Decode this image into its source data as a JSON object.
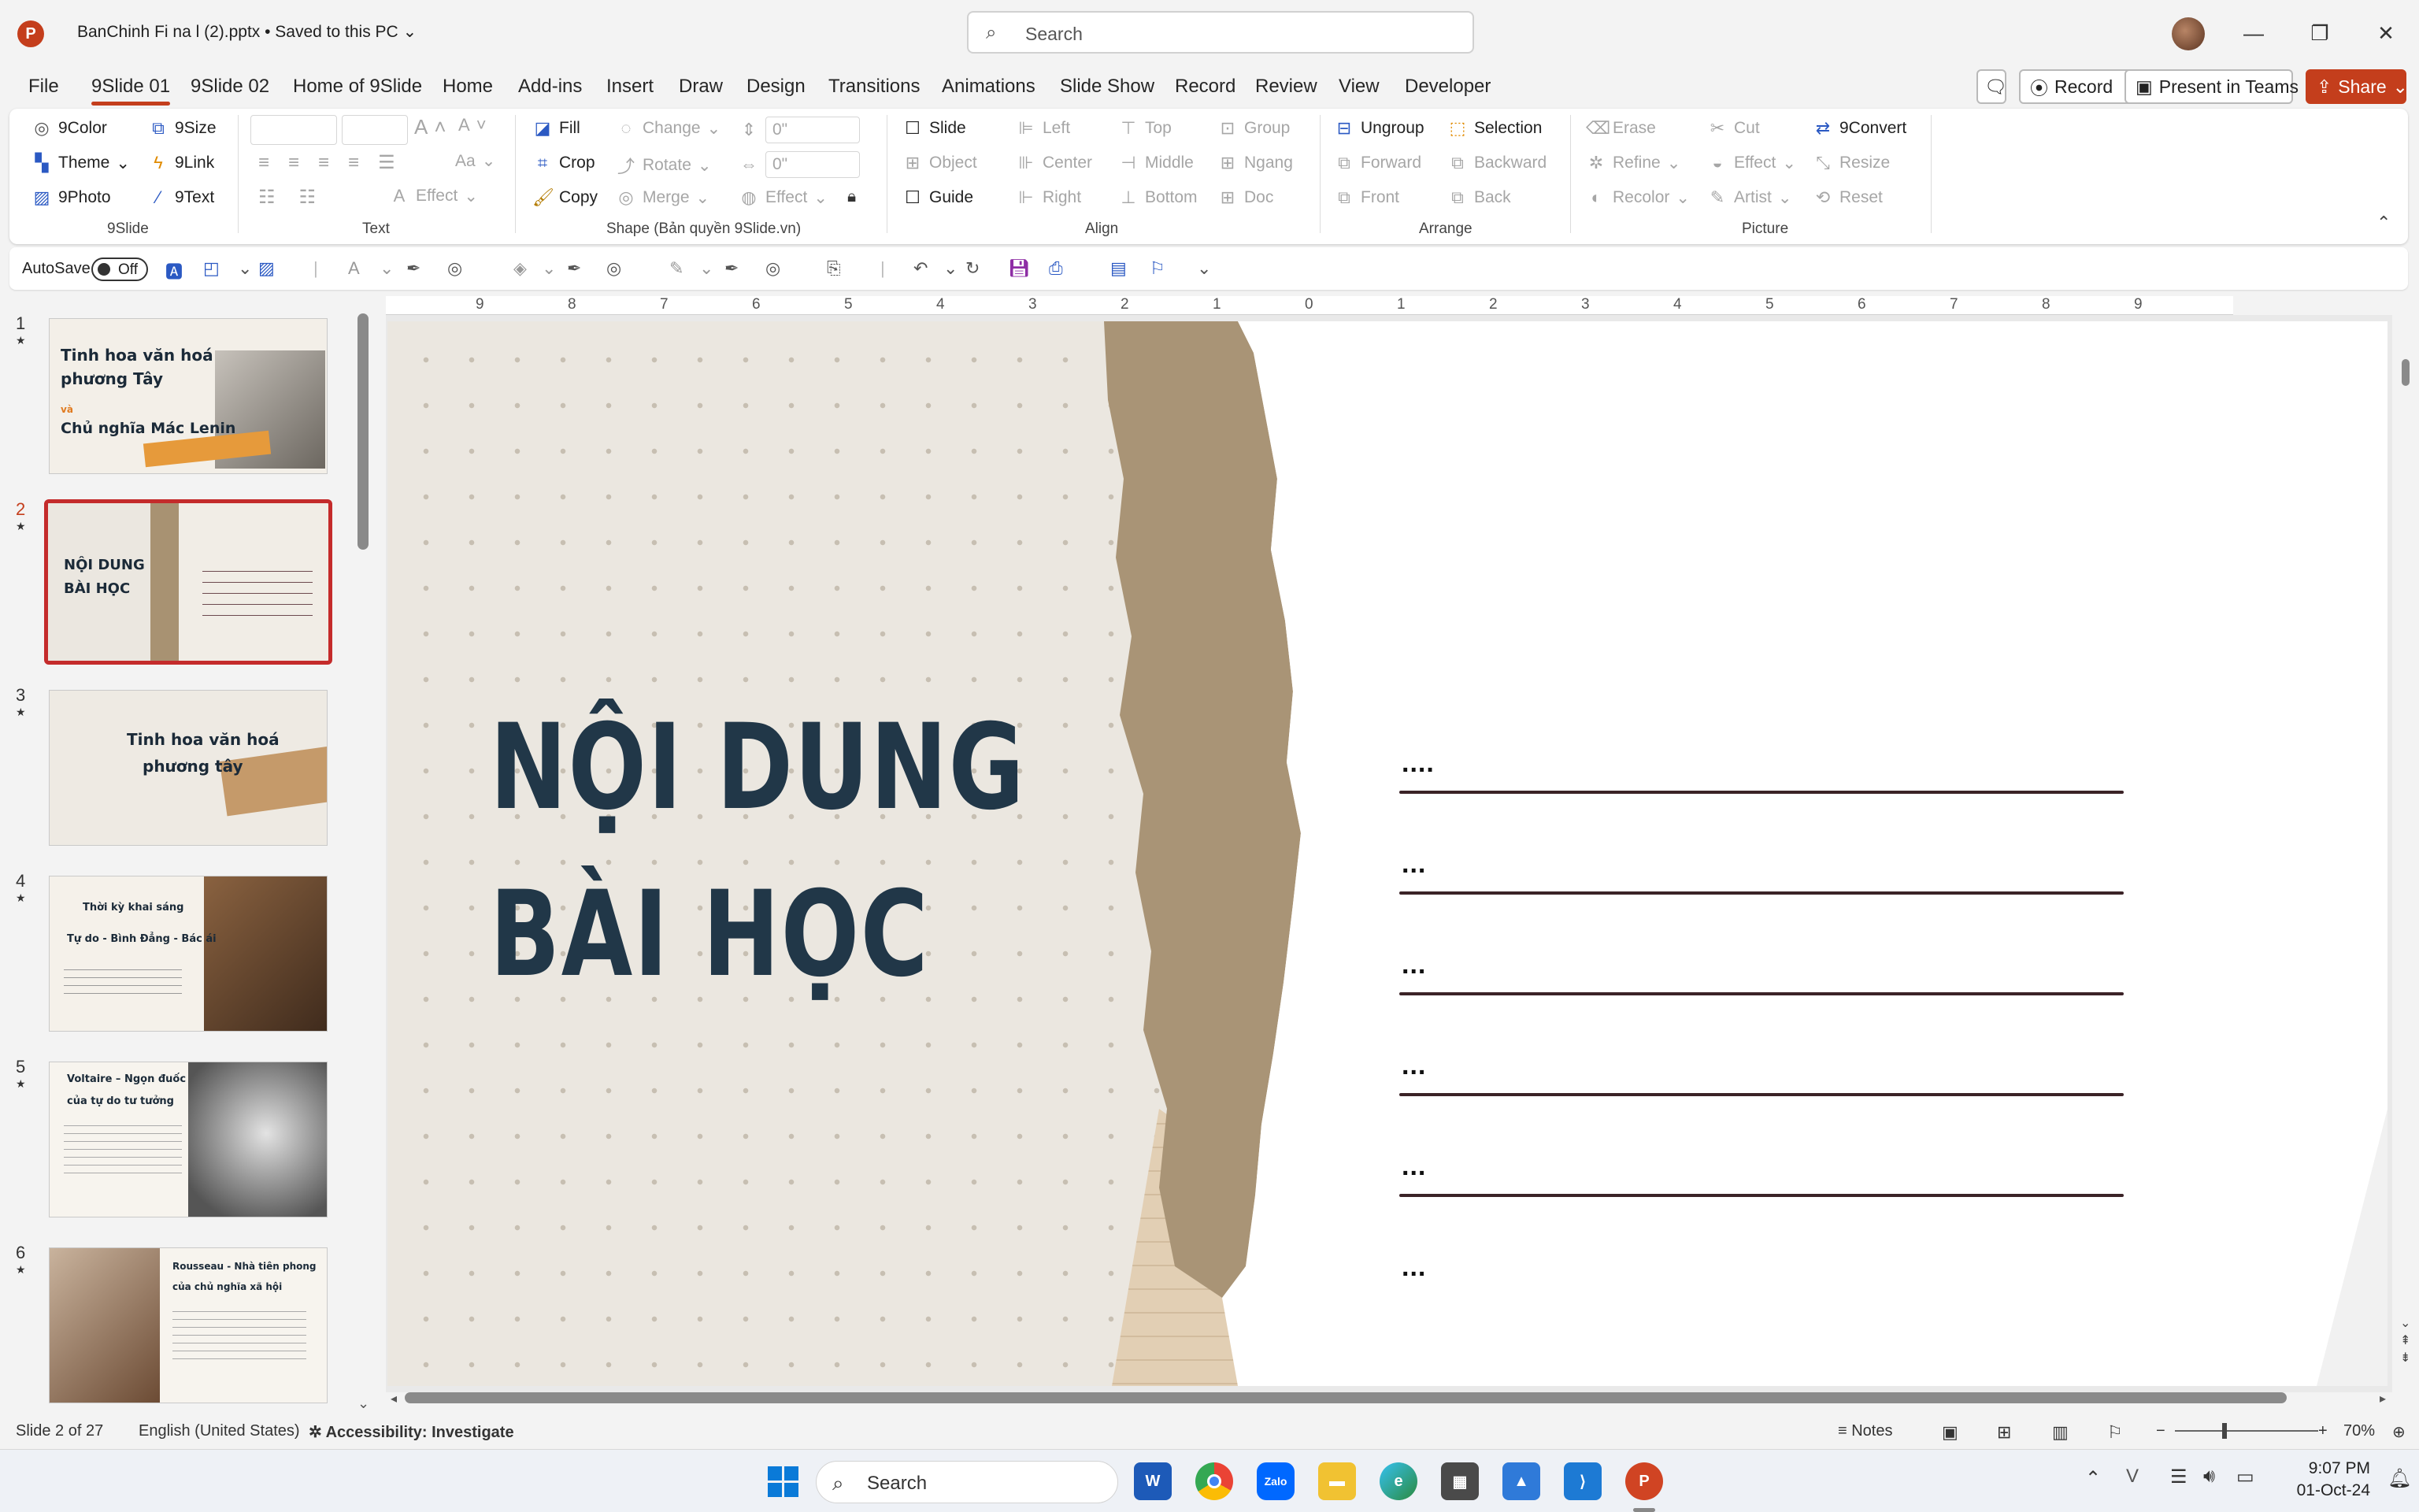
{
  "titlebar": {
    "app_icon": "P",
    "doc_title": "BanChinh Fi na l (2).pptx • Saved to this PC",
    "search_placeholder": "Search",
    "minimize": "—",
    "restore": "❐",
    "close": "✕"
  },
  "menu": {
    "tabs": [
      "File",
      "9Slide 01",
      "9Slide 02",
      "Home of 9Slide",
      "Home",
      "Add-ins",
      "Insert",
      "Draw",
      "Design",
      "Transitions",
      "Animations",
      "Slide Show",
      "Record",
      "Review",
      "View",
      "Developer"
    ],
    "record_label": "Record",
    "present_label": "Present in Teams",
    "share_label": "Share"
  },
  "ribbon": {
    "nineslide": {
      "color": "9Color",
      "theme": "Theme",
      "photo": "9Photo",
      "size": "9Size",
      "link": "9Link",
      "text": "9Text",
      "group": "9Slide"
    },
    "text": {
      "font_size_up": "A",
      "font_size_down": "A",
      "case": "Aa",
      "effect": "Effect",
      "group": "Text"
    },
    "shape": {
      "fill": "Fill",
      "crop": "Crop",
      "copy": "Copy",
      "change": "Change",
      "rotate": "Rotate",
      "merge": "Merge",
      "width_value": "0\"",
      "height_value": "0\"",
      "effect": "Effect",
      "group": "Shape (Bản quyền 9Slide.vn)"
    },
    "align": {
      "slide": "Slide",
      "object": "Object",
      "guide": "Guide",
      "left": "Left",
      "center": "Center",
      "right": "Right",
      "top": "Top",
      "middle": "Middle",
      "bottom": "Bottom",
      "group_btn": "Group",
      "ngang": "Ngang",
      "doc": "Doc",
      "group": "Align"
    },
    "arrange": {
      "ungroup": "Ungroup",
      "forward": "Forward",
      "front": "Front",
      "selection": "Selection",
      "backward": "Backward",
      "back": "Back",
      "group": "Arrange"
    },
    "picture": {
      "erase": "Erase",
      "refine": "Refine",
      "recolor": "Recolor",
      "cut": "Cut",
      "effect": "Effect",
      "artist": "Artist",
      "convert": "9Convert",
      "resize": "Resize",
      "reset": "Reset",
      "group": "Picture"
    }
  },
  "qat": {
    "autosave": "AutoSave",
    "autosave_state": "Off"
  },
  "thumbnails": {
    "numbers": [
      "1",
      "2",
      "3",
      "4",
      "5",
      "6"
    ],
    "s1": {
      "line1": "Tinh hoa văn hoá",
      "line2": "phương Tây",
      "line3": "và",
      "line4": "Chủ nghĩa Mác Lenin"
    },
    "s2": {
      "line1": "NỘI DUNG",
      "line2": "BÀI HỌC"
    },
    "s3": {
      "line1": "Tinh hoa văn hoá",
      "line2": "phương tây"
    },
    "s4": {
      "line1": "Thời kỳ khai sáng",
      "line2": "Tự do - Bình Đẳng - Bác ái"
    },
    "s5": {
      "line1": "Voltaire – Ngọn đuốc",
      "line2": "của tự do tư tưởng"
    },
    "s6": {
      "line1": "Rousseau - Nhà tiên phong",
      "line2": "của chủ nghĩa xã hội"
    }
  },
  "ruler": {
    "ticks": [
      "9",
      "8",
      "7",
      "6",
      "5",
      "4",
      "3",
      "2",
      "1",
      "0",
      "1",
      "2",
      "3",
      "4",
      "5",
      "6",
      "7",
      "8",
      "9"
    ]
  },
  "slide": {
    "title_line1": "NỘI DUNG",
    "title_line2": "BÀI HỌC",
    "items": [
      "....",
      "...",
      "...",
      "...",
      "...",
      "..."
    ]
  },
  "status": {
    "slide": "Slide 2 of 27",
    "language": "English (United States)",
    "accessibility": "Accessibility: Investigate",
    "notes": "Notes",
    "zoom": "70%"
  },
  "taskbar": {
    "search": "Search",
    "time": "9:07 PM",
    "date": "01-Oct-24"
  }
}
